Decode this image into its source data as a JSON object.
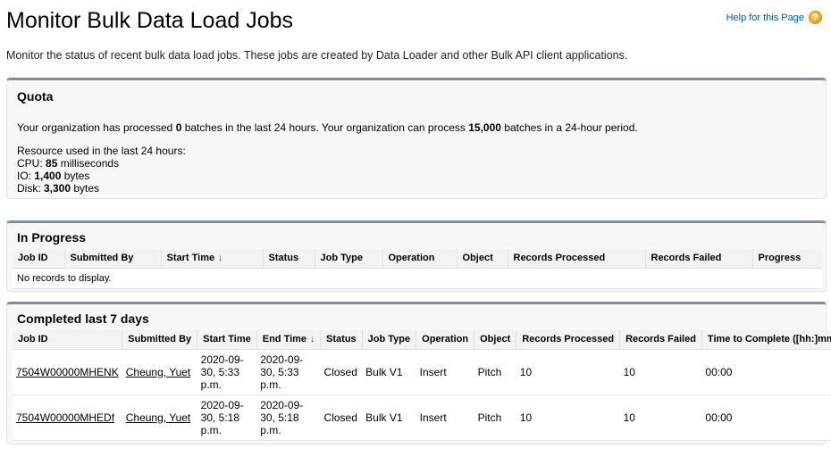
{
  "page": {
    "title": "Monitor Bulk Data Load Jobs",
    "help_link": "Help for this Page",
    "help_icon": "question-icon",
    "description": "Monitor the status of recent bulk data load jobs. These jobs are created by Data Loader and other Bulk API client applications."
  },
  "quota": {
    "title": "Quota",
    "line_prefix": "Your organization has processed ",
    "processed": "0",
    "line_middle": " batches in the last 24 hours. Your organization can process ",
    "capacity": "15,000",
    "line_suffix": " batches in a 24-hour period.",
    "resource_label": "Resource used in the last 24 hours:",
    "cpu_label": "CPU: ",
    "cpu_value": "85",
    "cpu_unit": " milliseconds",
    "io_label": "IO: ",
    "io_value": "1,400",
    "io_unit": " bytes",
    "disk_label": "Disk: ",
    "disk_value": "3,300",
    "disk_unit": " bytes"
  },
  "in_progress": {
    "title": "In Progress",
    "columns": [
      "Job ID",
      "Submitted By",
      "Start Time",
      "Status",
      "Job Type",
      "Operation",
      "Object",
      "Records Processed",
      "Records Failed",
      "Progress"
    ],
    "sort_arrow": "↓",
    "empty_message": "No records to display."
  },
  "completed": {
    "title": "Completed last 7 days",
    "columns": [
      "Job ID",
      "Submitted By",
      "Start Time",
      "End Time",
      "Status",
      "Job Type",
      "Operation",
      "Object",
      "Records Processed",
      "Records Failed",
      "Time to Complete ([hh:]mm:ss)"
    ],
    "sort_arrow": "↓",
    "rows": [
      {
        "job_id": "7504W00000MHENK",
        "submitted_by": "Cheung, Yuet",
        "start_time": "2020-09-30, 5:33 p.m.",
        "end_time": "2020-09-30, 5:33 p.m.",
        "status": "Closed",
        "job_type": "Bulk V1",
        "operation": "Insert",
        "object": "Pitch",
        "records_processed": "10",
        "records_failed": "10",
        "time_to_complete": "00:00"
      },
      {
        "job_id": "7504W00000MHEDf",
        "submitted_by": "Cheung, Yuet",
        "start_time": "2020-09-30, 5:18 p.m.",
        "end_time": "2020-09-30, 5:18 p.m.",
        "status": "Closed",
        "job_type": "Bulk V1",
        "operation": "Insert",
        "object": "Pitch",
        "records_processed": "10",
        "records_failed": "10",
        "time_to_complete": "00:00"
      }
    ]
  }
}
